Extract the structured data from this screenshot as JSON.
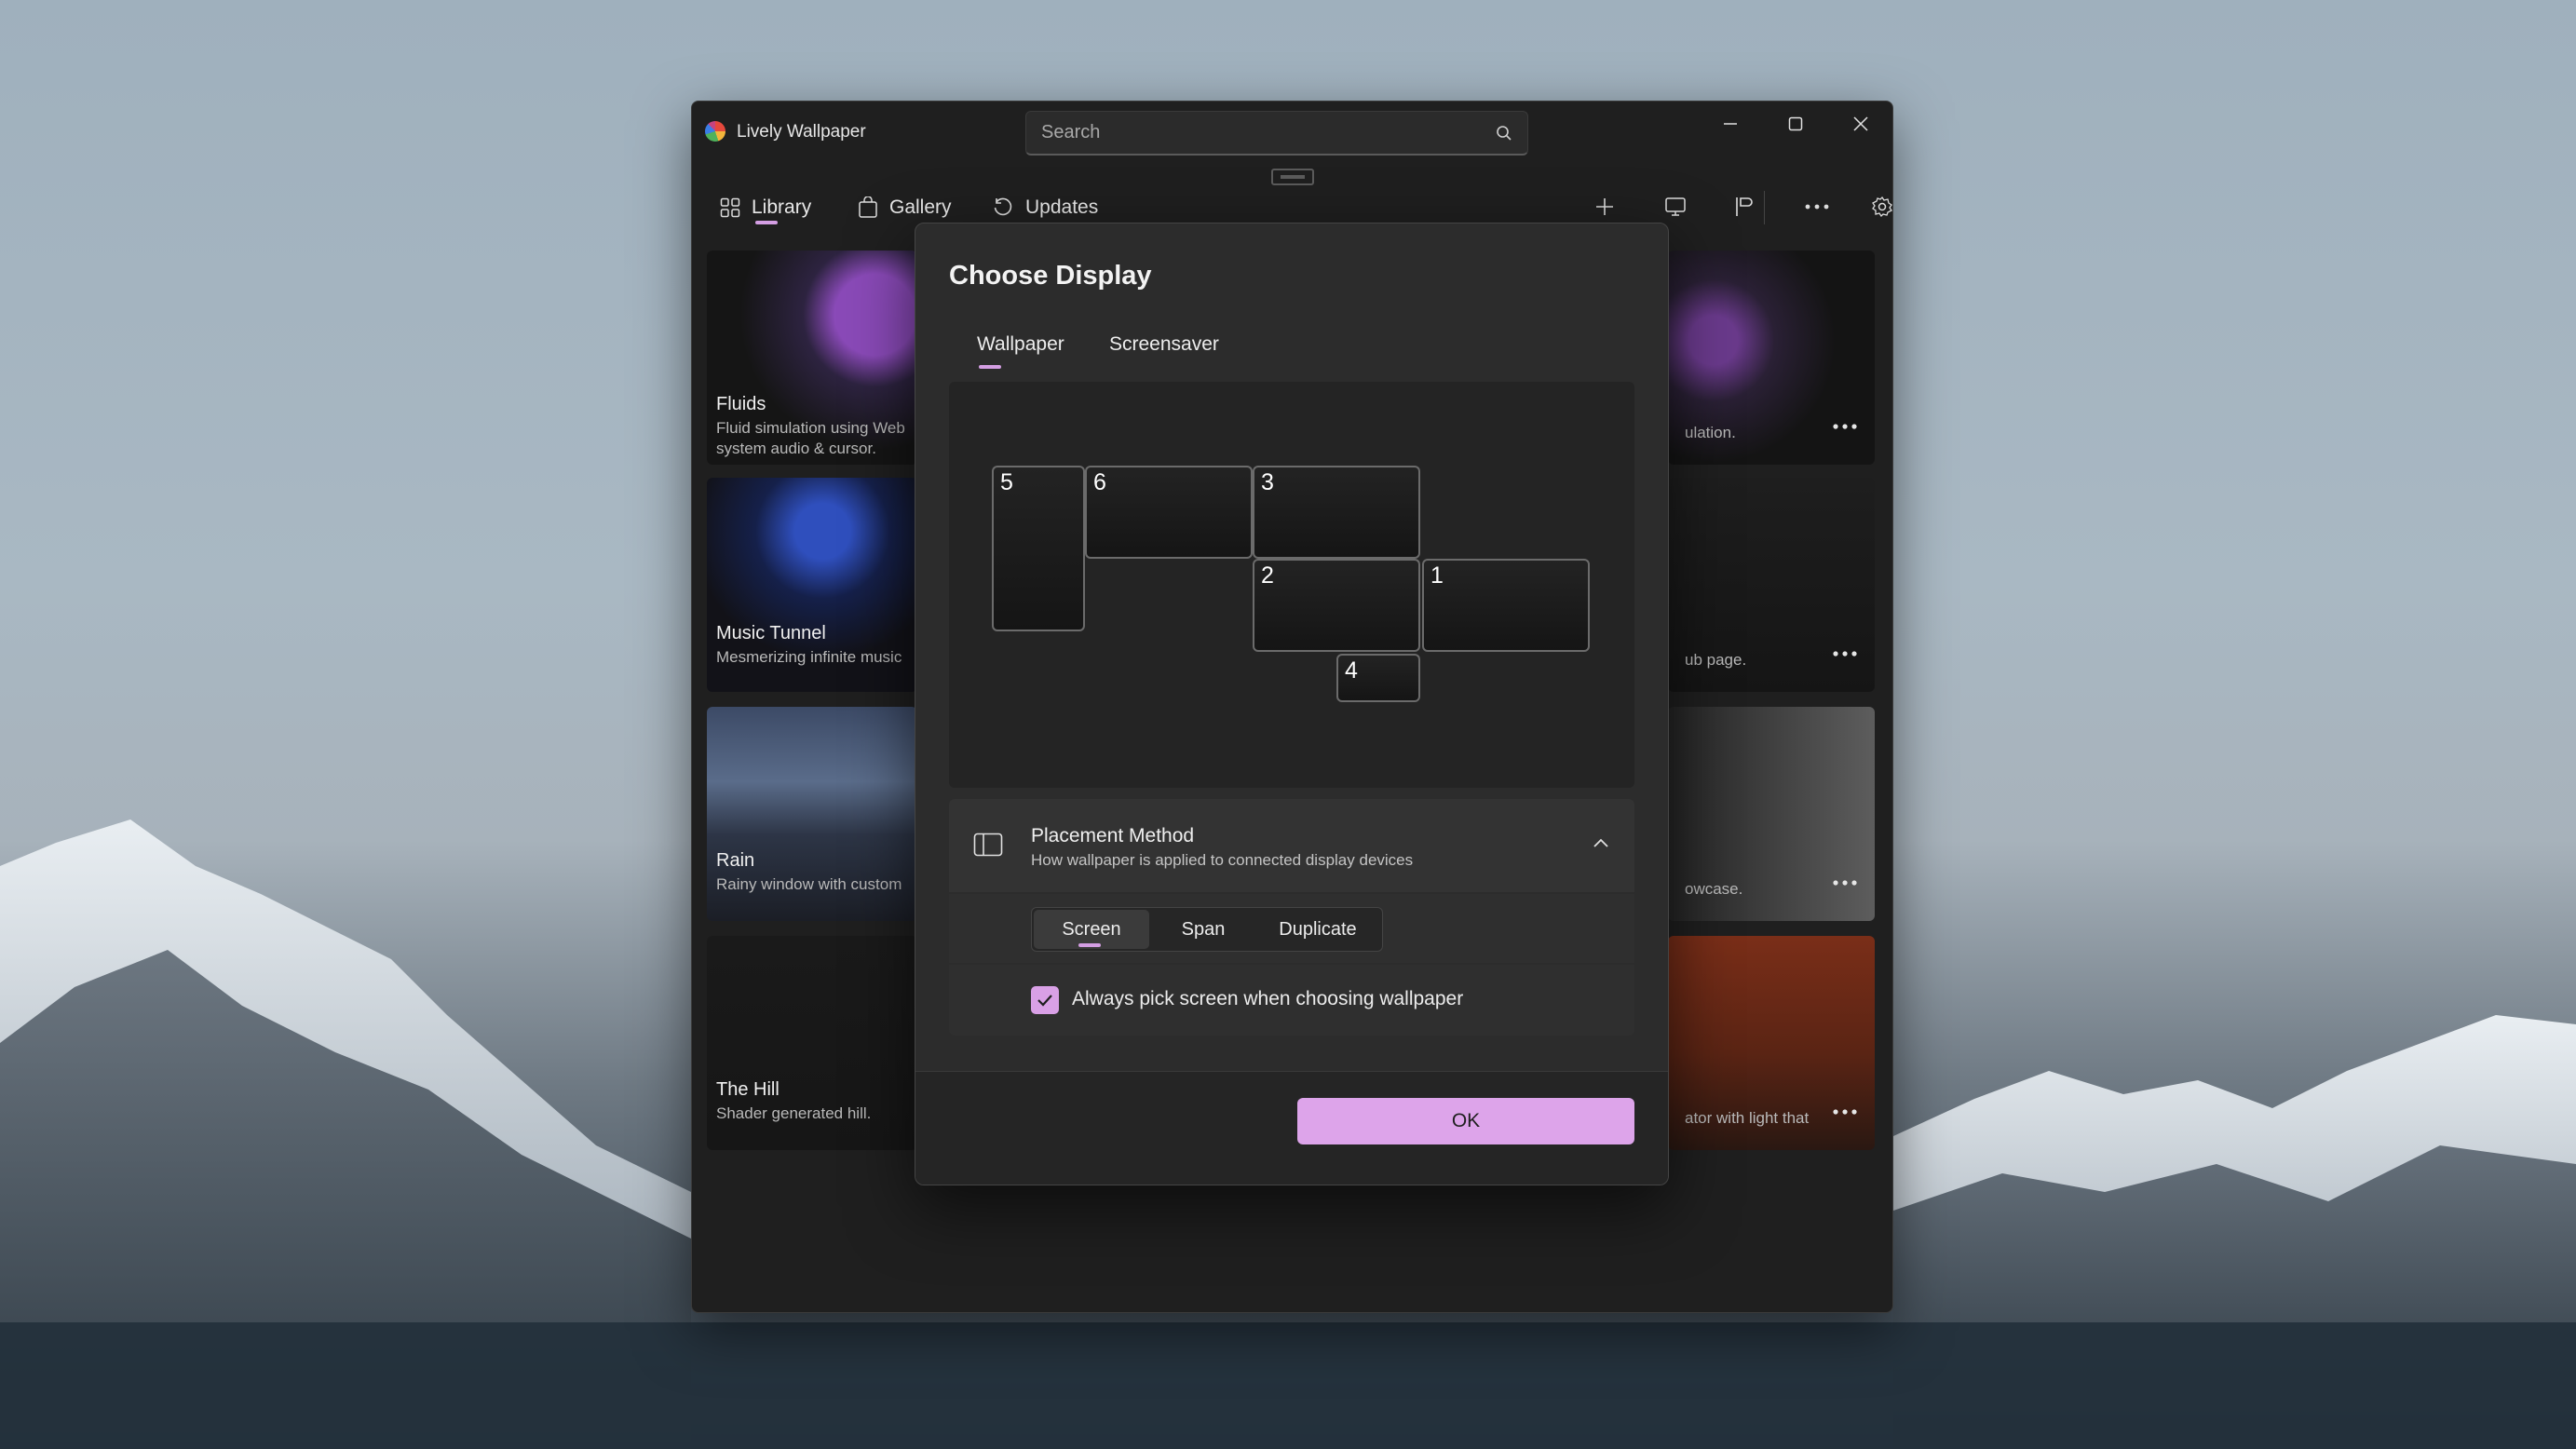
{
  "window": {
    "title": "Lively Wallpaper"
  },
  "search": {
    "placeholder": "Search"
  },
  "nav": {
    "tabs": [
      {
        "label": "Library"
      },
      {
        "label": "Gallery"
      },
      {
        "label": "Updates"
      }
    ]
  },
  "library": {
    "cards_left": [
      {
        "title": "Fluids",
        "desc": "Fluid simulation using Web system audio & cursor."
      },
      {
        "title": "Music Tunnel",
        "desc": "Mesmerizing infinite music"
      },
      {
        "title": "Rain",
        "desc": "Rainy window with custom"
      },
      {
        "title": "The Hill",
        "desc": "Shader generated hill."
      }
    ],
    "cards_right": [
      {
        "desc": "ulation."
      },
      {
        "desc": "ub page."
      },
      {
        "desc": "owcase."
      },
      {
        "desc": "ator with light that"
      }
    ]
  },
  "dialog": {
    "title": "Choose Display",
    "tabs": [
      {
        "label": "Wallpaper"
      },
      {
        "label": "Screensaver"
      }
    ],
    "monitors": [
      {
        "label": "5"
      },
      {
        "label": "6"
      },
      {
        "label": "3"
      },
      {
        "label": "2"
      },
      {
        "label": "1"
      },
      {
        "label": "4"
      }
    ],
    "placement": {
      "title": "Placement Method",
      "description": "How wallpaper is applied to connected display devices",
      "options": [
        {
          "label": "Screen"
        },
        {
          "label": "Span"
        },
        {
          "label": "Duplicate"
        }
      ],
      "selected": "Screen"
    },
    "checkbox": {
      "label": "Always pick screen when choosing wallpaper",
      "checked": true
    },
    "ok_label": "OK"
  },
  "colors": {
    "accent": "#d9a0e6",
    "window_bg": "#1f1f1f",
    "dialog_bg": "#2c2c2c"
  }
}
